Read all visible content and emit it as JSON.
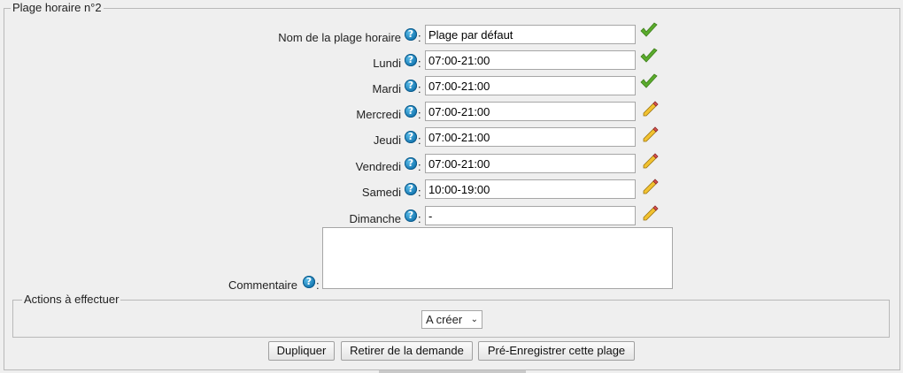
{
  "form": {
    "legend": "Plage horaire n°2",
    "help_glyph": "?",
    "colon": ":",
    "rows": [
      {
        "label": "Nom de la plage horaire",
        "value": "Plage par défaut",
        "status": "check-icon"
      },
      {
        "label": "Lundi",
        "value": "07:00-21:00",
        "status": "check-icon"
      },
      {
        "label": "Mardi",
        "value": "07:00-21:00",
        "status": "check-icon"
      },
      {
        "label": "Mercredi",
        "value": "07:00-21:00",
        "status": "pencil-icon"
      },
      {
        "label": "Jeudi",
        "value": "07:00-21:00",
        "status": "pencil-icon"
      },
      {
        "label": "Vendredi",
        "value": "07:00-21:00",
        "status": "pencil-icon"
      },
      {
        "label": "Samedi",
        "value": "10:00-19:00",
        "status": "pencil-icon"
      },
      {
        "label": "Dimanche",
        "value": "-",
        "status": "pencil-icon"
      }
    ],
    "comment": {
      "label": "Commentaire",
      "value": ""
    }
  },
  "actions": {
    "legend": "Actions à effectuer",
    "selected": "A créer",
    "chevron": "⌄"
  },
  "buttons": {
    "duplicate": "Dupliquer",
    "remove": "Retirer de la demande",
    "preregister": "Pré-Enregistrer cette plage"
  },
  "colors": {
    "check": "#5aab2c",
    "pencil_body": "#f2c230",
    "help": "#1577b1"
  }
}
